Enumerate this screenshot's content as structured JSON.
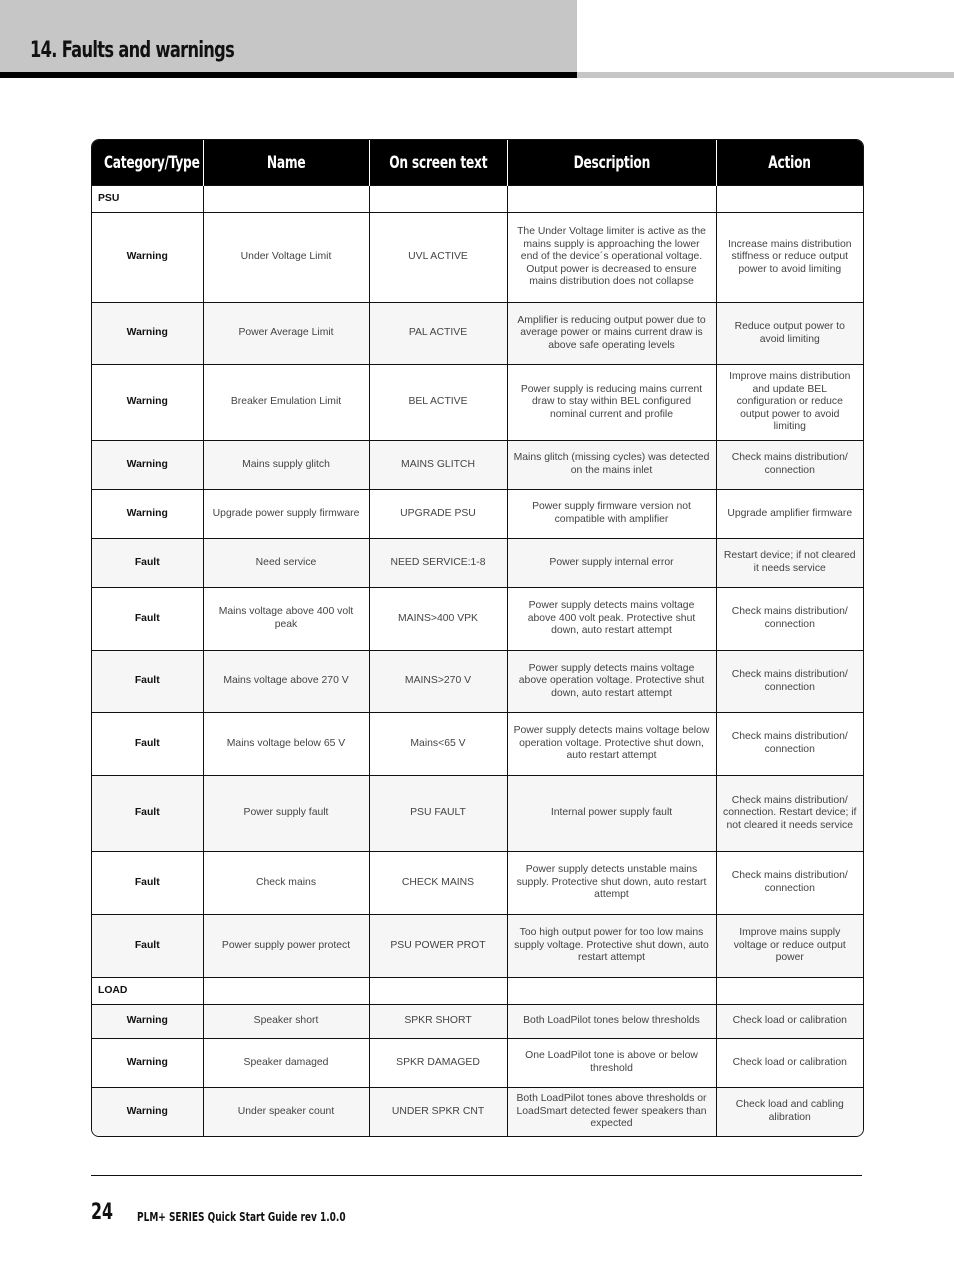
{
  "page": {
    "title": "14. Faults and warnings",
    "page_number": "24",
    "doc_title": "PLM+ SERIES  Quick Start Guide  rev 1.0.0"
  },
  "table": {
    "headers": [
      "Category/Type",
      "Name",
      "On screen text",
      "Description",
      "Action"
    ],
    "sections": [
      {
        "label": "PSU",
        "rows": [
          {
            "type": "Warning",
            "name": "Under Voltage Limit",
            "screen": "UVL ACTIVE",
            "description": "The Under Voltage limiter is active as the mains supply is approaching the lower end of the device´s operational voltage. Output power is decreased to ensure mains distribution does not collapse",
            "action": "Increase mains distribution stiffness or reduce output power to avoid limiting"
          },
          {
            "type": "Warning",
            "name": "Power Average Limit",
            "screen": "PAL ACTIVE",
            "description": "Amplifier is reducing output power due to average power or mains current draw is above safe operating levels",
            "action": "Reduce output power to avoid limiting"
          },
          {
            "type": "Warning",
            "name": "Breaker Emulation Limit",
            "screen": "BEL ACTIVE",
            "description": "Power supply is reducing mains current draw to stay within BEL configured nominal current and profile",
            "action": "Improve mains distribution and update BEL configuration or reduce output power to avoid limiting"
          },
          {
            "type": "Warning",
            "name": "Mains supply glitch",
            "screen": "MAINS GLITCH",
            "description": "Mains glitch (missing cycles) was detected on the mains inlet",
            "action": "Check mains distribution/ connection"
          },
          {
            "type": "Warning",
            "name": "Upgrade power supply firmware",
            "screen": "UPGRADE PSU",
            "description": "Power supply firmware version not compatible with amplifier",
            "action": "Upgrade amplifier firmware"
          },
          {
            "type": "Fault",
            "name": "Need service",
            "screen": "NEED SERVICE:1-8",
            "description": "Power supply internal error",
            "action": "Restart device; if not cleared it needs service"
          },
          {
            "type": "Fault",
            "name": "Mains voltage above 400 volt peak",
            "screen": "MAINS>400 VPK",
            "description": "Power supply detects mains voltage above 400 volt peak. Protective shut down, auto restart attempt",
            "action": "Check mains distribution/ connection"
          },
          {
            "type": "Fault",
            "name": "Mains voltage above 270 V",
            "screen": "MAINS>270 V",
            "description": "Power supply detects mains voltage above operation voltage. Protective shut down, auto restart attempt",
            "action": "Check mains distribution/ connection"
          },
          {
            "type": "Fault",
            "name": "Mains voltage below 65 V",
            "screen": "Mains<65 V",
            "description": "Power supply detects mains voltage below operation voltage. Protective shut down, auto restart attempt",
            "action": "Check mains distribution/ connection"
          },
          {
            "type": "Fault",
            "name": "Power supply fault",
            "screen": "PSU FAULT",
            "description": "Internal power supply fault",
            "action": "Check mains distribution/ connection. Restart device; if not cleared it needs service"
          },
          {
            "type": "Fault",
            "name": "Check mains",
            "screen": "CHECK MAINS",
            "description": "Power supply detects unstable mains supply. Protective shut down, auto restart attempt",
            "action": "Check mains distribution/ connection"
          },
          {
            "type": "Fault",
            "name": "Power supply power protect",
            "screen": "PSU POWER PROT",
            "description": "Too high output power for too low mains supply voltage. Protective shut down, auto restart attempt",
            "action": "Improve mains supply voltage or reduce output power"
          }
        ]
      },
      {
        "label": "LOAD",
        "rows": [
          {
            "type": "Warning",
            "name": "Speaker short",
            "screen": "SPKR SHORT",
            "description": "Both LoadPilot tones below thresholds",
            "action": "Check load or calibration"
          },
          {
            "type": "Warning",
            "name": "Speaker damaged",
            "screen": "SPKR DAMAGED",
            "description": "One LoadPilot tone is above or below threshold",
            "action": "Check load or calibration"
          },
          {
            "type": "Warning",
            "name": "Under speaker count",
            "screen": "UNDER SPKR CNT",
            "description": "Both LoadPilot tones above thresholds or LoadSmart detected fewer speakers than expected",
            "action": "Check load and cabling alibration"
          }
        ]
      }
    ]
  }
}
